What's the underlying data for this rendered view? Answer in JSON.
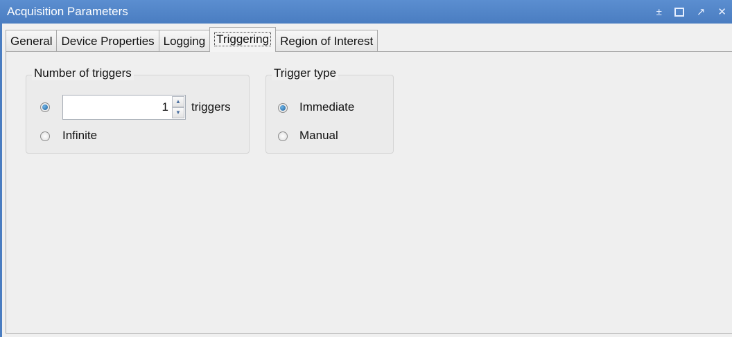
{
  "window": {
    "title": "Acquisition Parameters",
    "controls": {
      "minimize": "±",
      "restore": "",
      "undock": "↗",
      "close": "✕"
    }
  },
  "tabs": [
    {
      "label": "General"
    },
    {
      "label": "Device Properties"
    },
    {
      "label": "Logging"
    },
    {
      "label": "Triggering",
      "active": true
    },
    {
      "label": "Region of Interest"
    }
  ],
  "triggers": {
    "group_label": "Number of triggers",
    "count_value": "1",
    "count_unit": "triggers",
    "infinite_label": "Infinite",
    "selected": "count"
  },
  "trigger_type": {
    "group_label": "Trigger type",
    "immediate_label": "Immediate",
    "manual_label": "Manual",
    "selected": "immediate"
  },
  "colors": {
    "titlebar": "#4a7dc1",
    "radio_selected": "#1f5f9a",
    "panel_bg": "#efefef"
  }
}
